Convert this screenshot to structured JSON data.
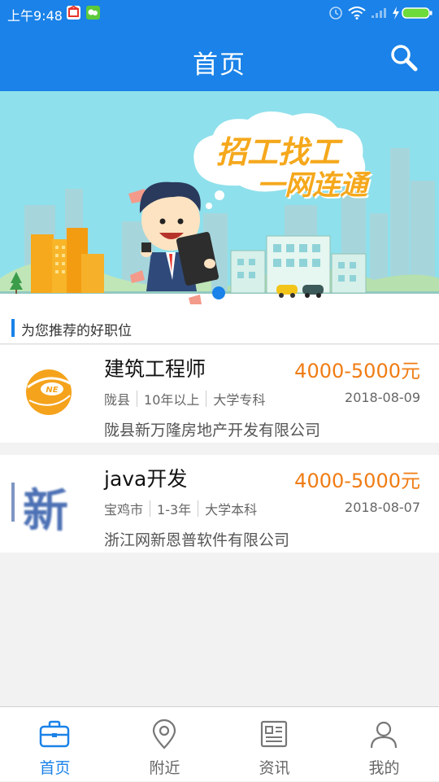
{
  "status_bar": {
    "time": "上午9:48",
    "colors": {
      "background": "#1a82e8"
    }
  },
  "header": {
    "title": "首页",
    "search_icon": "search-icon"
  },
  "banner": {
    "line1": "招工找工",
    "line2": "一网连通",
    "active_slide": 1
  },
  "section": {
    "title": "为您推荐的好职位"
  },
  "jobs": [
    {
      "title": "建筑工程师",
      "salary": "4000-5000元",
      "location": "陇县",
      "experience": "10年以上",
      "education": "大学专科",
      "date": "2018-08-09",
      "company": "陇县新万隆房地产开发有限公司"
    },
    {
      "title": "java开发",
      "salary": "4000-5000元",
      "location": "宝鸡市",
      "experience": "1-3年",
      "education": "大学本科",
      "date": "2018-08-07",
      "company": "浙江网新恩普软件有限公司",
      "logo_text": "新"
    }
  ],
  "bottom_nav": {
    "items": [
      {
        "label": "首页",
        "icon": "briefcase-icon",
        "active": true
      },
      {
        "label": "附近",
        "icon": "location-pin-icon",
        "active": false
      },
      {
        "label": "资讯",
        "icon": "news-icon",
        "active": false
      },
      {
        "label": "我的",
        "icon": "user-icon",
        "active": false
      }
    ]
  },
  "colors": {
    "accent": "#1a82e8",
    "salary": "#f07c14"
  }
}
